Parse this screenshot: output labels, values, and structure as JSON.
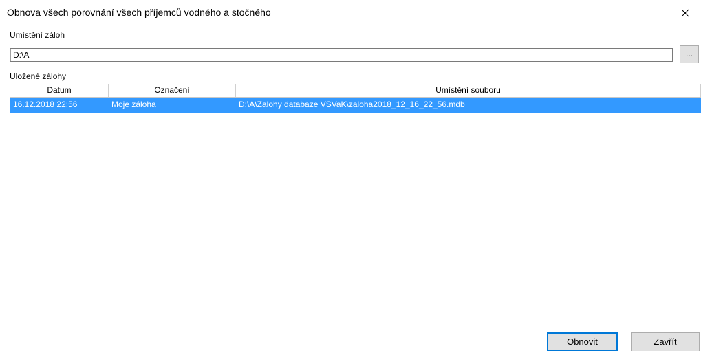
{
  "window": {
    "title": "Obnova všech porovnání všech příjemců vodného a stočného",
    "close_icon": "close-icon"
  },
  "location": {
    "label": "Umístění záloh",
    "path_value": "D:\\A",
    "browse_label": "..."
  },
  "backups": {
    "label": "Uložené zálohy",
    "columns": [
      "Datum",
      "Označení",
      "Umístění souboru"
    ],
    "rows": [
      {
        "date": "16.12.2018 22:56",
        "name": "Moje záloha",
        "file": "D:\\A\\Zalohy databaze VSVaK\\zaloha2018_12_16_22_56.mdb",
        "selected": true
      }
    ]
  },
  "buttons": {
    "restore": "Obnovit",
    "close": "Zavřít"
  },
  "colors": {
    "selection": "#3399ff",
    "default_button_border": "#0078d7"
  }
}
